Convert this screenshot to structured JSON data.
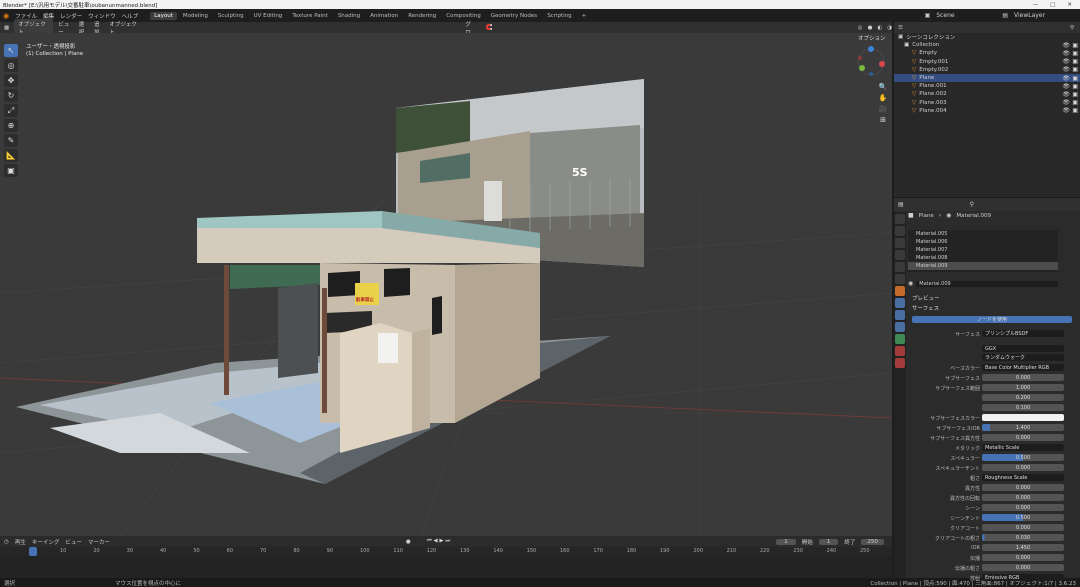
{
  "window": {
    "title": "Blender* [E:\\汎用モデル\\交番駐車\\oubanunmanned.blend]",
    "minimize": "—",
    "maximize": "□",
    "close": "✕"
  },
  "menus": [
    "ファイル",
    "編集",
    "レンダー",
    "ウィンドウ",
    "ヘルプ"
  ],
  "workspaces": [
    {
      "label": "Layout",
      "active": true
    },
    {
      "label": "Modeling"
    },
    {
      "label": "Sculpting"
    },
    {
      "label": "UV Editing"
    },
    {
      "label": "Texture Paint"
    },
    {
      "label": "Shading"
    },
    {
      "label": "Animation"
    },
    {
      "label": "Rendering"
    },
    {
      "label": "Compositing"
    },
    {
      "label": "Geometry Nodes"
    },
    {
      "label": "Scripting"
    },
    {
      "label": "+"
    }
  ],
  "scene": {
    "name": "Scene",
    "view_layer": "ViewLayer"
  },
  "viewport": {
    "mode": "オブジェクト",
    "menus": [
      "ビュー",
      "選択",
      "追加",
      "オブジェクト"
    ],
    "transform": "グロ…",
    "options": "オプション",
    "view_name": "ユーザー・透視投影",
    "collection_info": "(1) Collection | Plane",
    "sign_text": "5S",
    "no_parking": "駐車禁止"
  },
  "outliner": {
    "root": "シーンコレクション",
    "items": [
      {
        "label": "Collection",
        "level": 0
      },
      {
        "label": "Empty",
        "level": 1
      },
      {
        "label": "Empty.001",
        "level": 1
      },
      {
        "label": "Empty.002",
        "level": 1
      },
      {
        "label": "Plane",
        "level": 1,
        "selected": true
      },
      {
        "label": "Plane.001",
        "level": 1
      },
      {
        "label": "Plane.002",
        "level": 1
      },
      {
        "label": "Plane.003",
        "level": 1
      },
      {
        "label": "Plane.004",
        "level": 1
      }
    ]
  },
  "properties": {
    "breadcrumb_object": "Plane",
    "breadcrumb_material": "Material.009",
    "materials": [
      "Material.005",
      "Material.006",
      "Material.007",
      "Material.008",
      "Material.009"
    ],
    "active_material": "Material.009",
    "preview": "プレビュー",
    "surface_section": "サーフェス",
    "use_nodes": "ノードを使用",
    "surface_label": "サーフェス",
    "surface_value": "プリンシプルBSDF",
    "distribution": "GGX",
    "subsurface_method": "ランダムウォーク",
    "rows": [
      {
        "label": "ベースカラー",
        "value": "Base Color Multiplier RGB",
        "kind": "link"
      },
      {
        "label": "サブサーフェス",
        "value": "0.000"
      },
      {
        "label": "サブサーフェス範囲",
        "value": "1.000"
      },
      {
        "label": "",
        "value": "0.200"
      },
      {
        "label": "",
        "value": "0.100"
      },
      {
        "label": "サブサーフェスカラー",
        "value": "",
        "kind": "white"
      },
      {
        "label": "サブサーフェスIOR",
        "value": "1.400",
        "fill": 0.1
      },
      {
        "label": "サブサーフェス異方性",
        "value": "0.000"
      },
      {
        "label": "メタリック",
        "value": "Metallic Scale",
        "kind": "link"
      },
      {
        "label": "スペキュラー",
        "value": "0.500",
        "fill": 0.5
      },
      {
        "label": "スペキュラーチント",
        "value": "0.000"
      },
      {
        "label": "粗さ",
        "value": "Roughness Scale",
        "kind": "link"
      },
      {
        "label": "異方性",
        "value": "0.000"
      },
      {
        "label": "異方性の回転",
        "value": "0.000"
      },
      {
        "label": "シーン",
        "value": "0.000"
      },
      {
        "label": "シーンチント",
        "value": "0.500",
        "fill": 0.5
      },
      {
        "label": "クリアコート",
        "value": "0.000"
      },
      {
        "label": "クリアコートの粗さ",
        "value": "0.030",
        "fill": 0.03
      },
      {
        "label": "IOR",
        "value": "1.450"
      },
      {
        "label": "伝播",
        "value": "0.000"
      },
      {
        "label": "伝播の粗さ",
        "value": "0.000"
      }
    ],
    "last_row_label": "放射",
    "last_row_value": "Emissive RGB"
  },
  "timeline": {
    "menus": [
      "再生",
      "キーイング",
      "ビュー",
      "マーカー"
    ],
    "current_frame": "1",
    "start_label": "開始",
    "start": "1",
    "end_label": "終了",
    "end": "250",
    "ticks": [
      "1",
      "10",
      "20",
      "30",
      "40",
      "50",
      "60",
      "70",
      "80",
      "90",
      "100",
      "110",
      "120",
      "130",
      "140",
      "150",
      "160",
      "170",
      "180",
      "190",
      "200",
      "210",
      "220",
      "230",
      "240",
      "250"
    ]
  },
  "status": {
    "select": "選択",
    "hint": "マウス位置を視点の中心に",
    "stats": "Collection | Plane | 頂点:590 | 面:470 | 三角面:867 | オブジェクト:1/7 | 3.6.23"
  },
  "colors": {
    "accent": "#4772b3",
    "selection": "#334d80",
    "viewport_bg": "#3a3a3a"
  }
}
